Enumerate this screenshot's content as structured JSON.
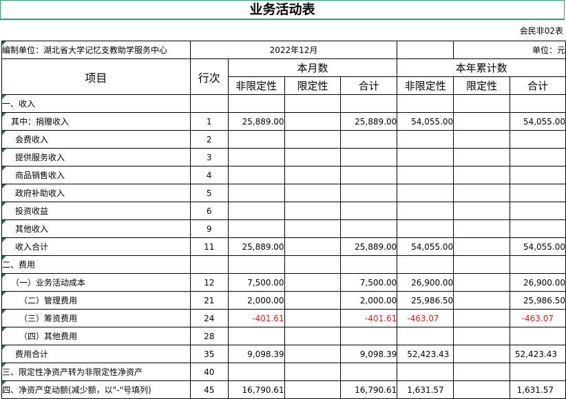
{
  "title": "业务活动表",
  "form_code": "会民非02表",
  "org": "编制单位：湖北省大学记忆支教助学服务中心",
  "period": "2022年12月",
  "unit": "单位：元",
  "headers": {
    "item": "项目",
    "line_no": "行次",
    "month_group": "本月数",
    "ytd_group": "本年累计数",
    "unrestricted": "非限定性",
    "restricted": "限定性",
    "total": "合计"
  },
  "rows": [
    {
      "item": "一、收入",
      "line": "",
      "m_unres": "",
      "m_res": "",
      "m_total": "",
      "y_unres": "",
      "y_res": "",
      "y_total": ""
    },
    {
      "item": "其中：捐赠收入",
      "line": "1",
      "m_unres": "25,889.00",
      "m_res": "",
      "m_total": "25,889.00",
      "y_unres": "54,055.00",
      "y_res": "",
      "y_total": "54,055.00"
    },
    {
      "item": "会费收入",
      "line": "2",
      "m_unres": "",
      "m_res": "",
      "m_total": "",
      "y_unres": "",
      "y_res": "",
      "y_total": ""
    },
    {
      "item": "提供服务收入",
      "line": "3",
      "m_unres": "",
      "m_res": "",
      "m_total": "",
      "y_unres": "",
      "y_res": "",
      "y_total": ""
    },
    {
      "item": "商品销售收入",
      "line": "4",
      "m_unres": "",
      "m_res": "",
      "m_total": "",
      "y_unres": "",
      "y_res": "",
      "y_total": ""
    },
    {
      "item": "政府补助收入",
      "line": "5",
      "m_unres": "",
      "m_res": "",
      "m_total": "",
      "y_unres": "",
      "y_res": "",
      "y_total": ""
    },
    {
      "item": "投资收益",
      "line": "6",
      "m_unres": "",
      "m_res": "",
      "m_total": "",
      "y_unres": "",
      "y_res": "",
      "y_total": ""
    },
    {
      "item": "其他收入",
      "line": "9",
      "m_unres": "",
      "m_res": "",
      "m_total": "",
      "y_unres": "",
      "y_res": "",
      "y_total": ""
    },
    {
      "item": "收入合计",
      "line": "11",
      "m_unres": "25,889.00",
      "m_res": "",
      "m_total": "25,889.00",
      "y_unres": "54,055.00",
      "y_res": "",
      "y_total": "54,055.00"
    },
    {
      "item": "二、费用",
      "line": "",
      "m_unres": "",
      "m_res": "",
      "m_total": "",
      "y_unres": "",
      "y_res": "",
      "y_total": ""
    },
    {
      "item": "（一）业务活动成本",
      "line": "12",
      "m_unres": "7,500.00",
      "m_res": "",
      "m_total": "7,500.00",
      "y_unres": "26,900.00",
      "y_res": "",
      "y_total": "26,900.00"
    },
    {
      "item": "（二）管理费用",
      "line": "21",
      "m_unres": "2,000.00",
      "m_res": "",
      "m_total": "2,000.00",
      "y_unres": "25,986.50",
      "y_res": "",
      "y_total": "25,986.50"
    },
    {
      "item": "（三）筹资费用",
      "line": "24",
      "m_unres": "-401.61",
      "m_res": "",
      "m_total": "-401.61",
      "y_unres": "-463.07",
      "y_res": "",
      "y_total": "-463.07"
    },
    {
      "item": "（四）其他费用",
      "line": "28",
      "m_unres": "",
      "m_res": "",
      "m_total": "",
      "y_unres": "",
      "y_res": "",
      "y_total": ""
    },
    {
      "item": "费用合计",
      "line": "35",
      "m_unres": "9,098.39",
      "m_res": "",
      "m_total": "9,098.39",
      "y_unres": "52,423.43",
      "y_res": "",
      "y_total": "52,423.43"
    },
    {
      "item": "三、限定性净资产转为非限定性净资产",
      "line": "40",
      "m_unres": "",
      "m_res": "",
      "m_total": "",
      "y_unres": "",
      "y_res": "",
      "y_total": ""
    },
    {
      "item": "四、净资产变动额(减少额，以\"-\"号填列)",
      "line": "45",
      "m_unres": "16,790.61",
      "m_res": "",
      "m_total": "16,790.61",
      "y_unres": "1,631.57",
      "y_res": "",
      "y_total": "1,631.57"
    }
  ],
  "colors": {
    "title_border": "#2fa36b",
    "negative_text": "#e02020",
    "cell_marker": "#1f7a3a"
  }
}
